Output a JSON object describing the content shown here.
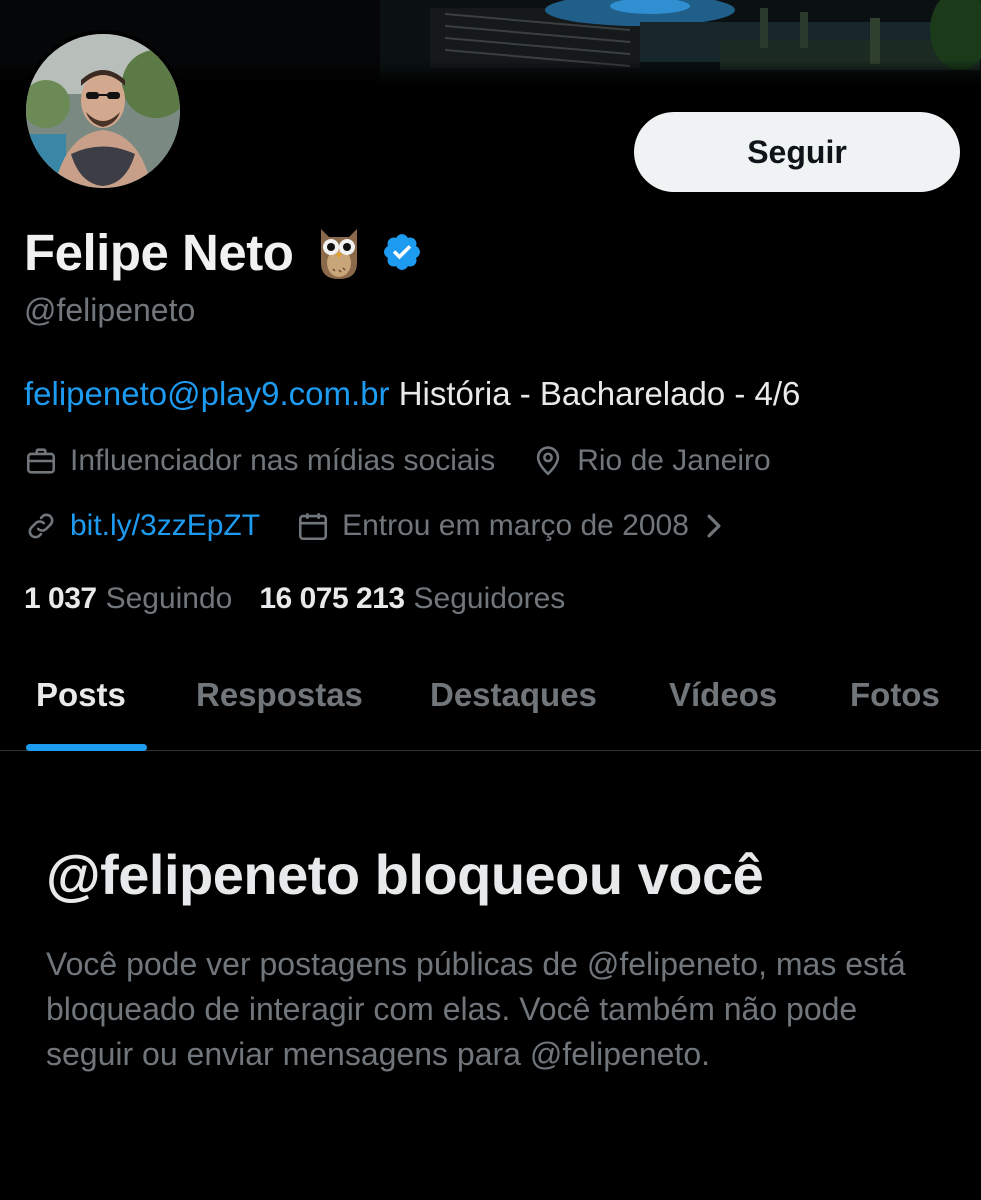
{
  "profile": {
    "display_name": "Felipe Neto",
    "handle": "@felipeneto",
    "bio_link": "felipeneto@play9.com.br",
    "bio_text": " História - Bacharelado - 4/6",
    "category": "Influenciador nas mídias sociais",
    "location": "Rio de Janeiro",
    "website": "bit.ly/3zzEpZT",
    "joined": "Entrou em março de 2008"
  },
  "actions": {
    "follow_label": "Seguir"
  },
  "stats": {
    "following_count": "1 037",
    "following_label": "Seguindo",
    "followers_count": "16 075 213",
    "followers_label": "Seguidores"
  },
  "tabs": [
    {
      "label": "Posts",
      "active": true
    },
    {
      "label": "Respostas",
      "active": false
    },
    {
      "label": "Destaques",
      "active": false
    },
    {
      "label": "Vídeos",
      "active": false
    },
    {
      "label": "Fotos",
      "active": false
    }
  ],
  "blocked": {
    "title": "@felipeneto bloqueou você",
    "message": "Você pode ver postagens públicas de @felipeneto, mas está bloqueado de interagir com elas. Você também não pode seguir ou enviar mensagens para @felipeneto."
  },
  "icons": {
    "verified": "verified-badge-icon",
    "emoji": "owl-icon",
    "category": "briefcase-icon",
    "location": "map-pin-icon",
    "website": "link-icon",
    "joined": "calendar-icon",
    "more": "chevron-right-icon"
  },
  "colors": {
    "background": "#000000",
    "accent": "#1d9bf0",
    "primary_text": "#e7e9ea",
    "secondary_text": "#71767b",
    "follow_button": "#eff3f4"
  }
}
